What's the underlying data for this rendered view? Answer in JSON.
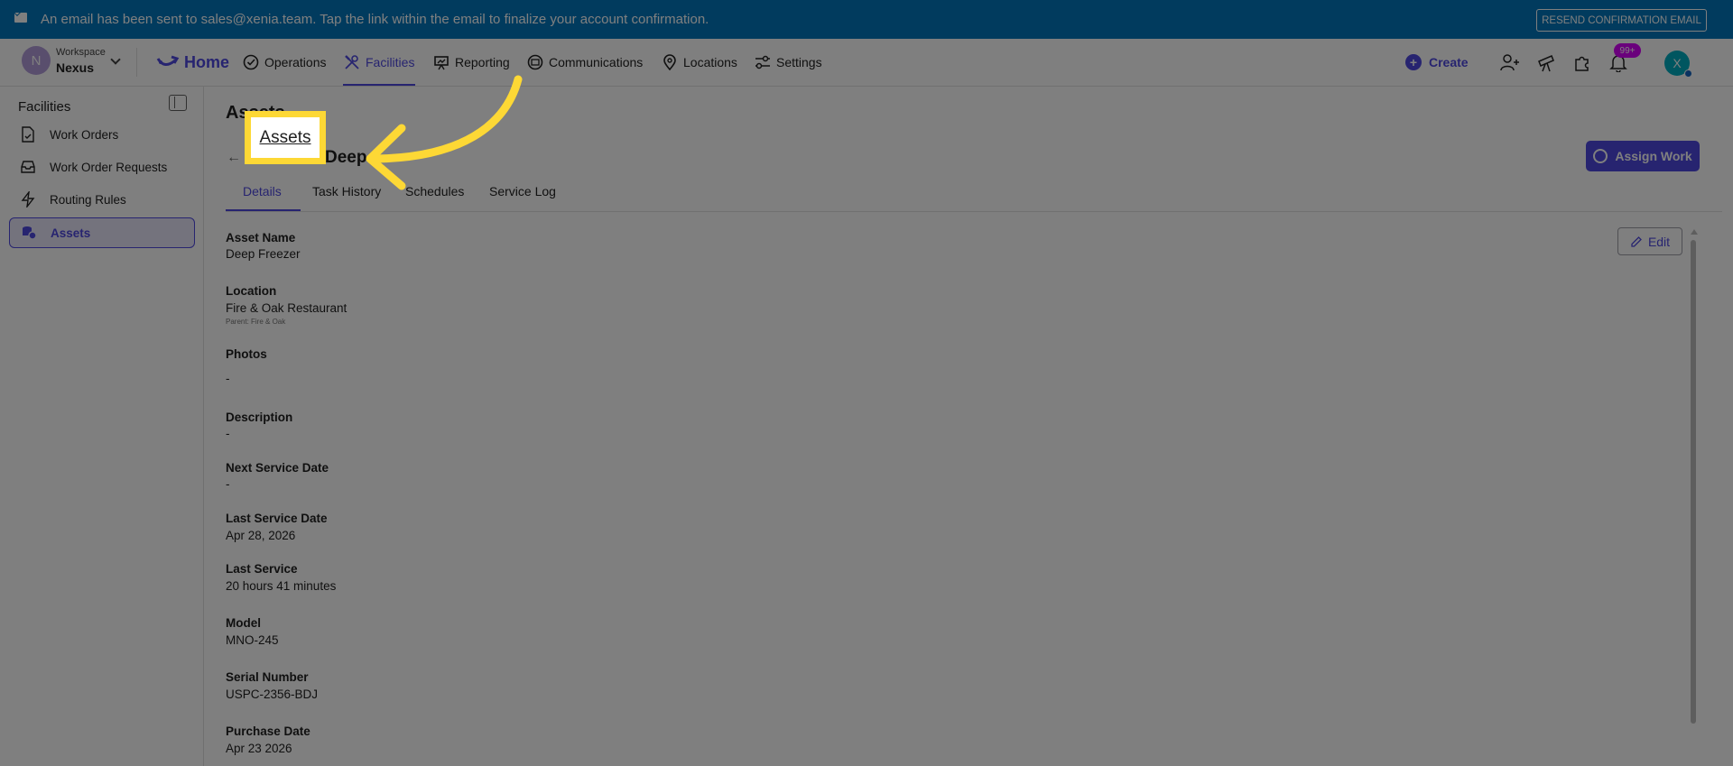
{
  "banner": {
    "message": "An email has been sent to sales@xenia.team. Tap the link within the email to finalize your account confirmation.",
    "resend_label": "RESEND CONFIRMATION EMAIL"
  },
  "workspace": {
    "label": "Workspace",
    "name": "Nexus",
    "initial": "N"
  },
  "nav": {
    "home": "Home",
    "operations": "Operations",
    "facilities": "Facilities",
    "reporting": "Reporting",
    "communications": "Communications",
    "locations": "Locations",
    "settings": "Settings",
    "create": "Create",
    "notification_count": "99+",
    "user_initial": "X"
  },
  "sidebar": {
    "title": "Facilities",
    "items": [
      {
        "label": "Work Orders",
        "icon": "document-icon"
      },
      {
        "label": "Work Order Requests",
        "icon": "inbox-icon"
      },
      {
        "label": "Routing Rules",
        "icon": "bolt-icon"
      },
      {
        "label": "Assets",
        "icon": "stack-icon"
      }
    ]
  },
  "main": {
    "page_title": "Assets",
    "breadcrumb_link": "Assets",
    "asset_title": "Deep",
    "assign_label": "Assign Work",
    "edit_label": "Edit",
    "tabs": [
      "Details",
      "Task History",
      "Schedules",
      "Service Log"
    ],
    "fields": [
      {
        "label": "Asset Name",
        "value": "Deep Freezer"
      },
      {
        "label": "Location",
        "value": "Fire & Oak Restaurant",
        "sub": "Parent: Fire & Oak"
      },
      {
        "label": "Photos",
        "value": "-"
      },
      {
        "label": "Description",
        "value": "-"
      },
      {
        "label": "Next Service Date",
        "value": "-"
      },
      {
        "label": "Last Service Date",
        "value": "Apr 28, 2026"
      },
      {
        "label": "Last Service",
        "value": "20 hours 41 minutes"
      },
      {
        "label": "Model",
        "value": "MNO-245"
      },
      {
        "label": "Serial Number",
        "value": "USPC-2356-BDJ"
      },
      {
        "label": "Purchase Date",
        "value": "Apr 23 2026"
      }
    ]
  },
  "colors": {
    "accent": "#4e48e0",
    "banner": "#0277bd",
    "highlight": "#fdd835"
  }
}
